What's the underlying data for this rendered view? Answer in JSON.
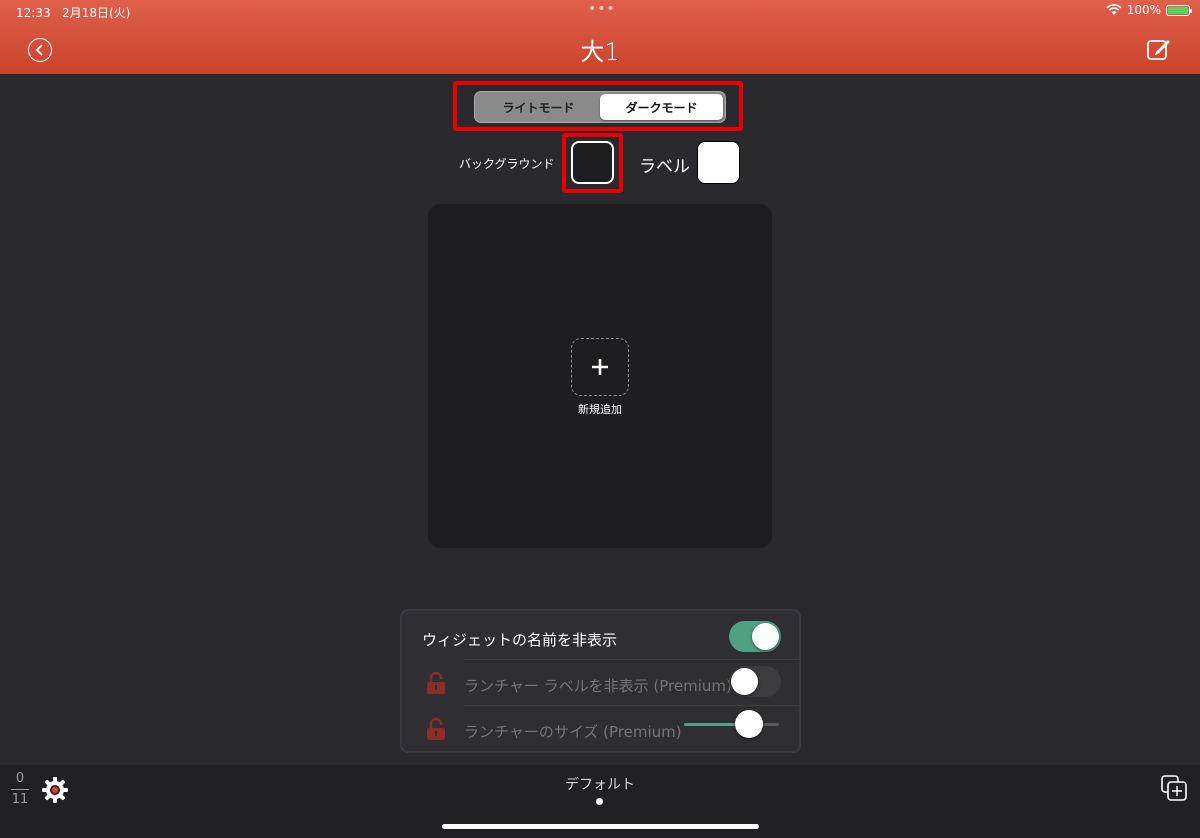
{
  "status": {
    "time": "12:33",
    "date": "2月18日(火)",
    "battery": "100%",
    "dots": "•••"
  },
  "header": {
    "title": "大1",
    "back_icon": "chevron-left-icon",
    "edit_icon": "compose-icon"
  },
  "mode": {
    "options": [
      "ライトモード",
      "ダークモード"
    ],
    "selected": "ダークモード"
  },
  "colors": {
    "background_label": "バックグラウンド",
    "background_color": "#1e1e21",
    "label_label": "ラベル",
    "label_color": "#ffffff",
    "accent": "#d6503b",
    "highlight": "#ea0000"
  },
  "canvas": {
    "add_icon": "plus-icon",
    "add_label": "新規追加"
  },
  "settings": {
    "hide_widget_name": {
      "label": "ウィジェットの名前を非表示",
      "enabled": true
    },
    "hide_launcher_label": {
      "label": "ランチャー ラベルを非表示 (Premium)",
      "enabled": false,
      "locked": true
    },
    "launcher_size": {
      "label": "ランチャーのサイズ (Premium)",
      "locked": true,
      "value": 0.68
    }
  },
  "bottom": {
    "counter_top": "0",
    "counter_bottom": "11",
    "page_name": "デフォルト",
    "settings_icon": "gear-icon",
    "copy_icon": "duplicate-icon"
  }
}
